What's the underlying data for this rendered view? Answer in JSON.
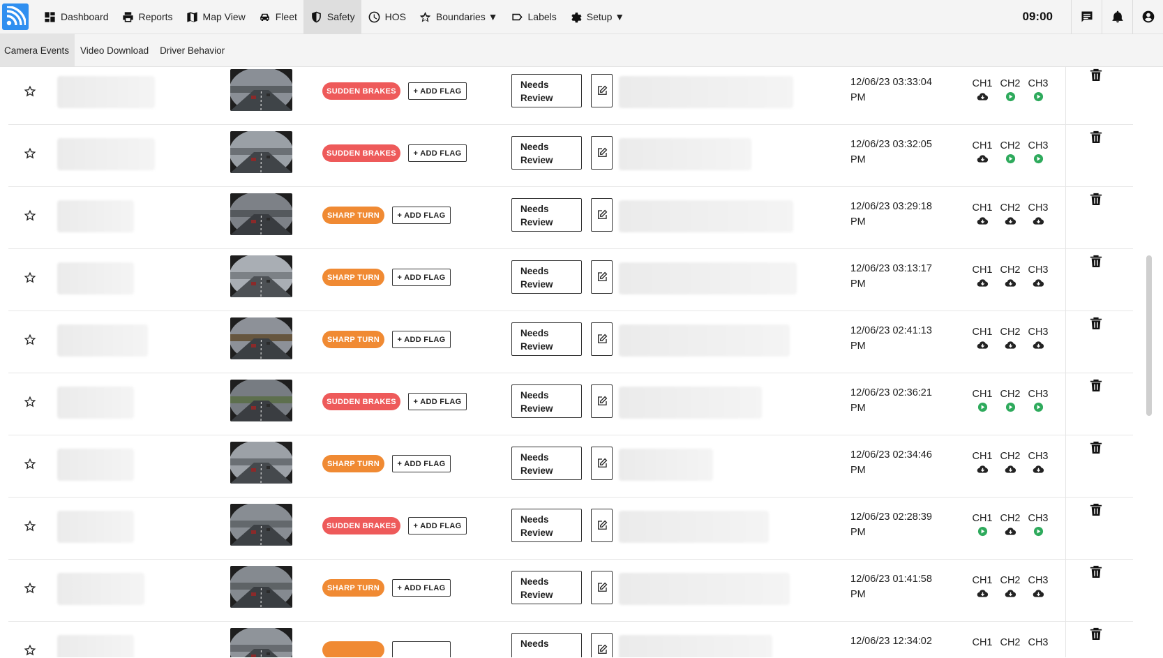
{
  "navbar": {
    "items": [
      {
        "label": "Dashboard",
        "icon": "dashboard-icon"
      },
      {
        "label": "Reports",
        "icon": "printer-icon"
      },
      {
        "label": "Map View",
        "icon": "map-icon"
      },
      {
        "label": "Fleet",
        "icon": "car-icon"
      },
      {
        "label": "Safety",
        "icon": "shield-icon",
        "active": true
      },
      {
        "label": "HOS",
        "icon": "clock-icon"
      },
      {
        "label": "Boundaries ▼",
        "icon": "star-icon"
      },
      {
        "label": "Labels",
        "icon": "label-icon"
      },
      {
        "label": "Setup ▼",
        "icon": "gear-icon"
      }
    ],
    "clock": "09:00"
  },
  "subtabs": [
    {
      "label": "Camera Events",
      "active": true
    },
    {
      "label": "Video Download"
    },
    {
      "label": "Driver Behavior"
    }
  ],
  "add_flag_label": "+ ADD FLAG",
  "rows": [
    {
      "event": "SUDDEN BRAKES",
      "kind": "sudden",
      "status": [
        "Needs",
        "Review"
      ],
      "date": "12/06/23 03:33:04",
      "ampm": "PM",
      "channels": [
        {
          "label": "CH1",
          "state": "cloud"
        },
        {
          "label": "CH2",
          "state": "play"
        },
        {
          "label": "CH3",
          "state": "play"
        }
      ]
    },
    {
      "event": "SUDDEN BRAKES",
      "kind": "sudden",
      "status": [
        "Needs",
        "Review"
      ],
      "date": "12/06/23 03:32:05",
      "ampm": "PM",
      "channels": [
        {
          "label": "CH1",
          "state": "cloud"
        },
        {
          "label": "CH2",
          "state": "play"
        },
        {
          "label": "CH3",
          "state": "play"
        }
      ]
    },
    {
      "event": "SHARP TURN",
      "kind": "sharp",
      "status": [
        "Needs",
        "Review"
      ],
      "date": "12/06/23 03:29:18",
      "ampm": "PM",
      "channels": [
        {
          "label": "CH1",
          "state": "cloud"
        },
        {
          "label": "CH2",
          "state": "cloud"
        },
        {
          "label": "CH3",
          "state": "cloud"
        }
      ]
    },
    {
      "event": "SHARP TURN",
      "kind": "sharp",
      "status": [
        "Needs",
        "Review"
      ],
      "date": "12/06/23 03:13:17",
      "ampm": "PM",
      "channels": [
        {
          "label": "CH1",
          "state": "cloud"
        },
        {
          "label": "CH2",
          "state": "cloud"
        },
        {
          "label": "CH3",
          "state": "cloud"
        }
      ]
    },
    {
      "event": "SHARP TURN",
      "kind": "sharp",
      "status": [
        "Needs",
        "Review"
      ],
      "date": "12/06/23 02:41:13",
      "ampm": "PM",
      "channels": [
        {
          "label": "CH1",
          "state": "cloud"
        },
        {
          "label": "CH2",
          "state": "cloud"
        },
        {
          "label": "CH3",
          "state": "cloud"
        }
      ]
    },
    {
      "event": "SUDDEN BRAKES",
      "kind": "sudden",
      "status": [
        "Needs",
        "Review"
      ],
      "date": "12/06/23 02:36:21",
      "ampm": "PM",
      "channels": [
        {
          "label": "CH1",
          "state": "play"
        },
        {
          "label": "CH2",
          "state": "play"
        },
        {
          "label": "CH3",
          "state": "play"
        }
      ]
    },
    {
      "event": "SHARP TURN",
      "kind": "sharp",
      "status": [
        "Needs",
        "Review"
      ],
      "date": "12/06/23 02:34:46",
      "ampm": "PM",
      "channels": [
        {
          "label": "CH1",
          "state": "cloud"
        },
        {
          "label": "CH2",
          "state": "cloud"
        },
        {
          "label": "CH3",
          "state": "cloud"
        }
      ]
    },
    {
      "event": "SUDDEN BRAKES",
      "kind": "sudden",
      "status": [
        "Needs",
        "Review"
      ],
      "date": "12/06/23 02:28:39",
      "ampm": "PM",
      "channels": [
        {
          "label": "CH1",
          "state": "play"
        },
        {
          "label": "CH2",
          "state": "cloud"
        },
        {
          "label": "CH3",
          "state": "play"
        }
      ]
    },
    {
      "event": "SHARP TURN",
      "kind": "sharp",
      "status": [
        "Needs",
        "Review"
      ],
      "date": "12/06/23 01:41:58",
      "ampm": "PM",
      "channels": [
        {
          "label": "CH1",
          "state": "cloud"
        },
        {
          "label": "CH2",
          "state": "cloud"
        },
        {
          "label": "CH3",
          "state": "cloud"
        }
      ]
    },
    {
      "event": "",
      "kind": "sharp",
      "status": [
        "Needs",
        ""
      ],
      "date": "12/06/23 12:34:02",
      "ampm": "",
      "channels": [
        {
          "label": "CH1",
          "state": "none"
        },
        {
          "label": "CH2",
          "state": "none"
        },
        {
          "label": "CH3",
          "state": "none"
        }
      ]
    }
  ],
  "colors": {
    "sudden_badge": "#ee5a5a",
    "sharp_badge": "#f08a33",
    "play_icon": "#2eaa5c",
    "logo": "#2f8ff0"
  }
}
